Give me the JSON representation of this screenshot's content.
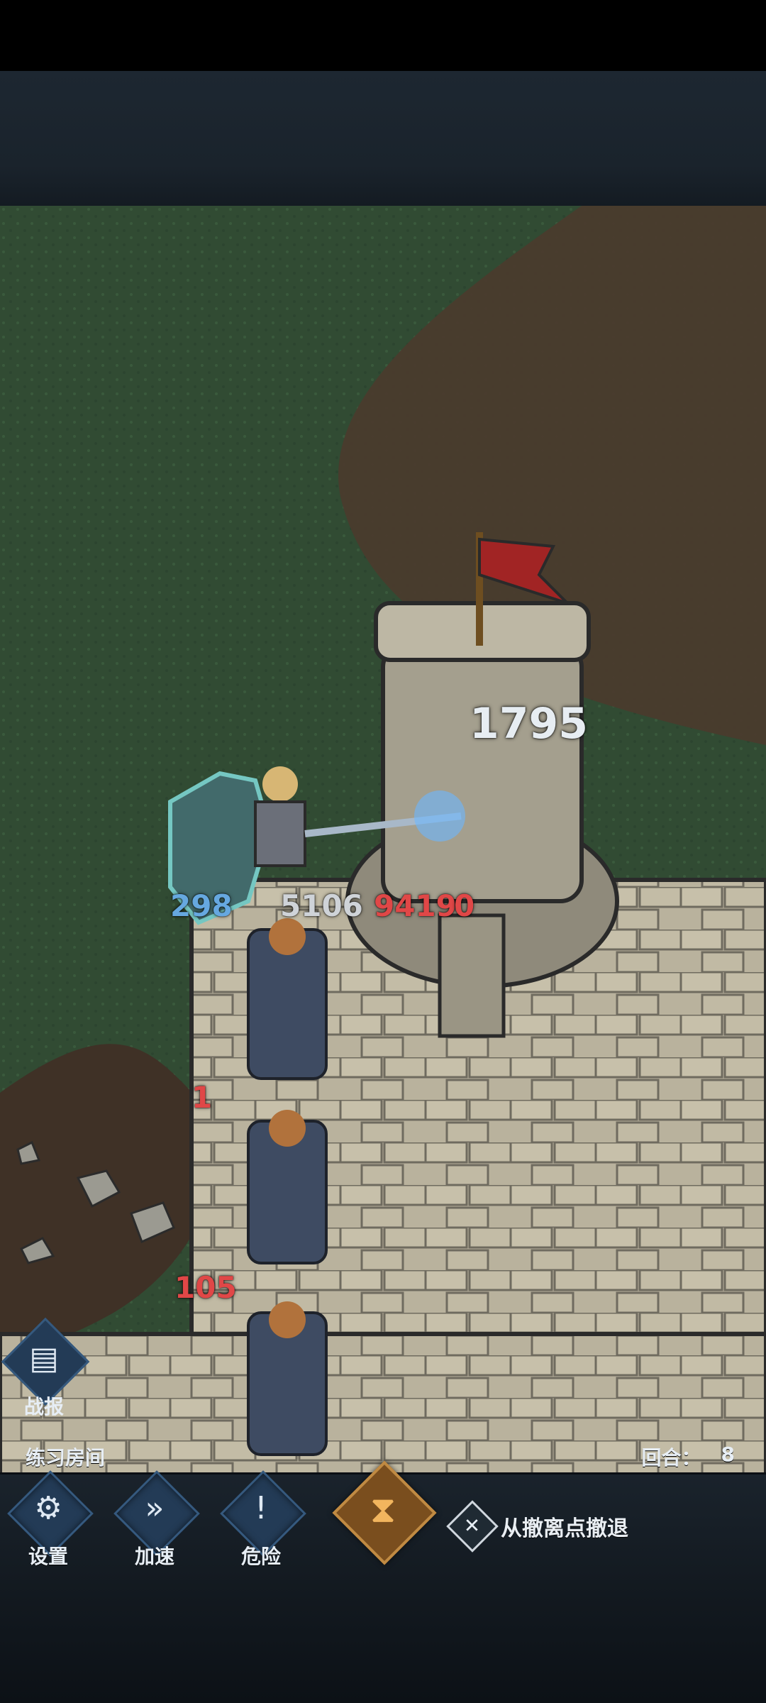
{
  "map": {
    "damage_text": "1795",
    "labels": {
      "p1_value": "298",
      "p2_value": "5106",
      "p3_value": "9419",
      "p4_value": "0",
      "e1_value": "1",
      "e2_value": "105"
    }
  },
  "hud": {
    "left_label": "练习房间",
    "round_label": "回合：",
    "round_value": "8"
  },
  "left_report": {
    "label": "战报"
  },
  "buttons": [
    {
      "label": "设置",
      "icon": "gear-icon"
    },
    {
      "label": "加速",
      "icon": "fast-forward-icon"
    },
    {
      "label": "危险",
      "icon": "exclamation-icon"
    }
  ],
  "center_button": {
    "icon": "hourglass-icon"
  },
  "retreat": {
    "label": "从撤离点撤退",
    "icon": "retreat-x-icon"
  }
}
